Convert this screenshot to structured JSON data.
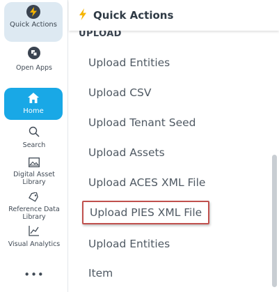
{
  "rail": {
    "quick_actions": "Quick Actions",
    "open_apps": "Open Apps",
    "home": "Home",
    "search": "Search",
    "digital_asset_library": "Digital Asset Library",
    "reference_data_library": "Reference Data Library",
    "visual_analytics": "Visual Analytics",
    "more": "•••"
  },
  "panel": {
    "title": "Quick Actions",
    "section": "UPLOAD",
    "actions": [
      "Upload Entities",
      "Upload CSV",
      "Upload Tenant Seed",
      "Upload Assets",
      "Upload ACES XML File",
      "Upload PIES XML File",
      "Upload Entities",
      "Item"
    ]
  },
  "colors": {
    "accent": "#19a8e6",
    "bolt": "#f5b400",
    "highlight_border": "#c0504d",
    "active_pill": "#dde9f2"
  }
}
